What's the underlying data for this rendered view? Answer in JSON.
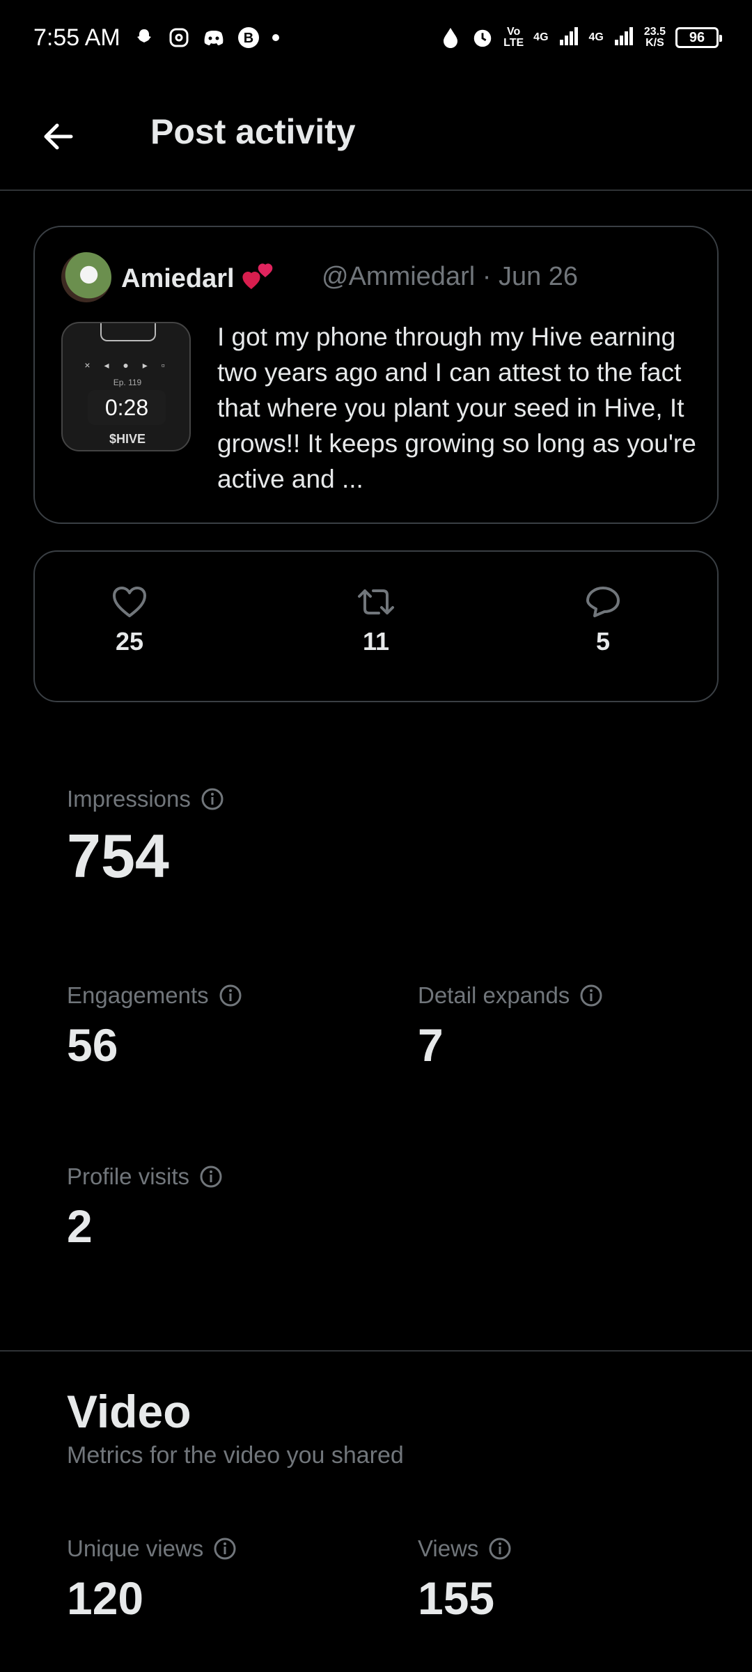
{
  "status_bar": {
    "time": "7:55 AM",
    "network_top": "Vo",
    "network_bottom": "LTE",
    "signal_1": "4G",
    "signal_2": "4G",
    "speed_top": "23.5",
    "speed_bottom": "K/S",
    "battery": "96",
    "icons": [
      "snapchat-icon",
      "threads-icon",
      "discord-icon",
      "bitcoin-icon",
      "dot-icon",
      "drop-icon",
      "alarm-icon"
    ]
  },
  "header": {
    "title": "Post activity"
  },
  "post": {
    "author": "Amiedarl",
    "handle": "@Ammiedarl · Jun 26",
    "video_duration": "0:28",
    "text": "I got my phone through my Hive earning two years ago and I can attest to the fact that where you plant your seed in Hive, It grows!! It keeps growing so long as you're active and ..."
  },
  "engagement": {
    "likes": "25",
    "reposts": "11",
    "replies": "5"
  },
  "metrics": {
    "impressions": {
      "label": "Impressions",
      "value": "754"
    },
    "engagements": {
      "label": "Engagements",
      "value": "56"
    },
    "detail_expands": {
      "label": "Detail expands",
      "value": "7"
    },
    "profile_visits": {
      "label": "Profile visits",
      "value": "2"
    }
  },
  "video": {
    "title": "Video",
    "subtitle": "Metrics for the video you shared",
    "unique_views": {
      "label": "Unique views",
      "value": "120"
    },
    "views": {
      "label": "Views",
      "value": "155"
    }
  },
  "colors": {
    "background": "#000000",
    "text_primary": "#e7e9ea",
    "text_secondary": "#71767b",
    "border": "#3a3f44",
    "heart_red": "#e0245e"
  }
}
